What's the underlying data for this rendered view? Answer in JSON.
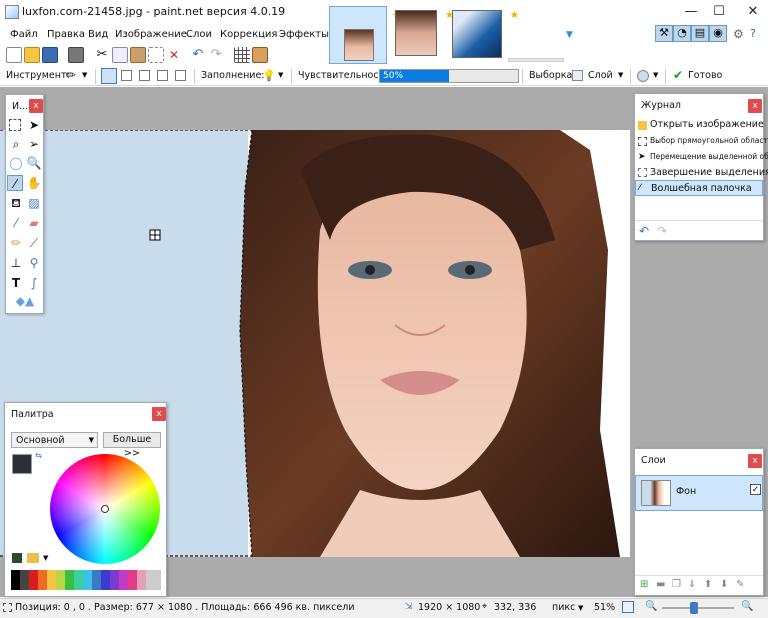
{
  "window": {
    "title": "luxfon.com-21458.jpg - paint.net версия 4.0.19",
    "minimize": "—",
    "maximize": "☐",
    "close": "✕"
  },
  "menu": [
    "Файл",
    "Правка",
    "Вид",
    "Изображение",
    "Слои",
    "Коррекция",
    "Эффекты"
  ],
  "toolbar2": {
    "instrument_label": "Инструмент:",
    "fill_label": "Заполнение:",
    "sensitivity_label": "Чувствительность:",
    "sensitivity_value": "50%",
    "sensitivity_fraction": 0.5,
    "selection_label": "Выборка:",
    "selection_value": "Слой",
    "done_label": "Готово"
  },
  "tools_panel": {
    "title": "И...",
    "close": "x"
  },
  "journal": {
    "title": "Журнал",
    "close": "x",
    "items": [
      "Открыть изображение",
      "Выбор прямоугольной области",
      "Перемещение выделенной области",
      "Завершение выделения",
      "Волшебная палочка"
    ]
  },
  "palette": {
    "title": "Палитра",
    "close": "x",
    "mode": "Основной",
    "more_button": "Больше >>"
  },
  "layers": {
    "title": "Слои",
    "close": "x",
    "layer_name": "Фон"
  },
  "status": {
    "position": "Позиция: 0 , 0 . Размер: 677 × 1080 . Площадь: 666 496 кв. пиксели",
    "image_size": "1920 × 1080",
    "cursor": "332, 336",
    "units": "пикс",
    "zoom": "51%"
  },
  "colors": {
    "accent": "#0b7de0",
    "panel_border": "#9fa8b4",
    "canvas_bg": "#c8dcec",
    "workspace": "#ababab"
  }
}
